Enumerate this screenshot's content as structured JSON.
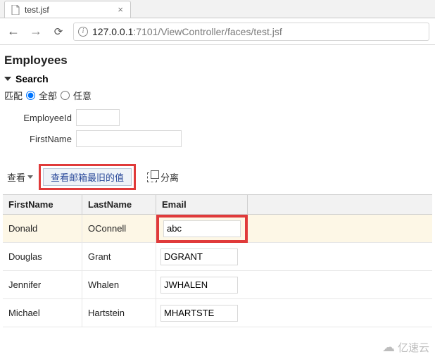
{
  "browser": {
    "tab_title": "test.jsf",
    "url_host": "127.0.0.1",
    "url_path": ":7101/ViewController/faces/test.jsf",
    "close_glyph": "×"
  },
  "page": {
    "title": "Employees",
    "search_header": "Search",
    "match_label": "匹配",
    "match_all": "全部",
    "match_any": "任意",
    "field_employee_id": "EmployeeId",
    "field_first_name": "FirstName"
  },
  "toolbar": {
    "view_label": "查看",
    "custom_button": "查看邮箱最旧的值",
    "detach_label": "分离"
  },
  "table": {
    "headers": {
      "a": "FirstName",
      "b": "LastName",
      "c": "Email"
    },
    "rows": [
      {
        "first": "Donald",
        "last": "OConnell",
        "email": "abc",
        "selected": true,
        "highlight_email": true
      },
      {
        "first": "Douglas",
        "last": "Grant",
        "email": "DGRANT",
        "selected": false,
        "highlight_email": false
      },
      {
        "first": "Jennifer",
        "last": "Whalen",
        "email": "JWHALEN",
        "selected": false,
        "highlight_email": false
      },
      {
        "first": "Michael",
        "last": "Hartstein",
        "email": "MHARTSTE",
        "selected": false,
        "highlight_email": false
      }
    ]
  },
  "watermark": "亿速云"
}
